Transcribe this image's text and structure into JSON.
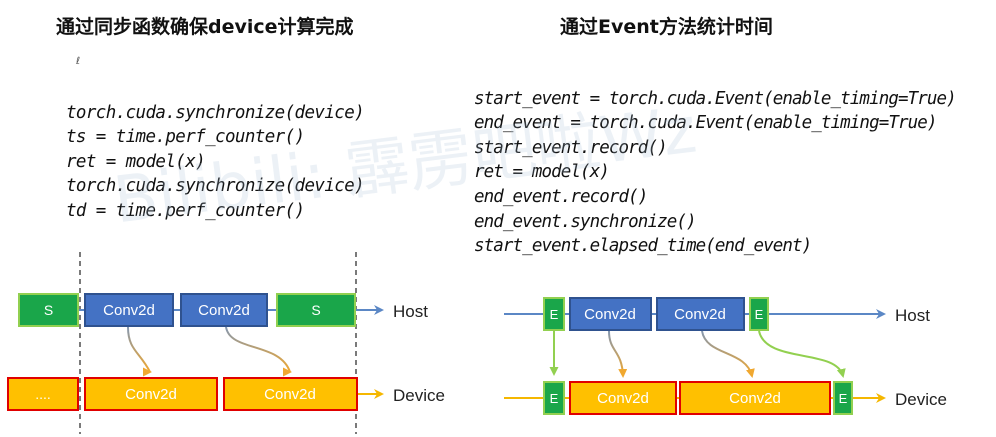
{
  "left": {
    "title": "通过同步函数确保device计算完成",
    "code_lines": [
      "torch.cuda.synchronize(device)",
      "ts = time.perf_counter()",
      "ret = model(x)",
      "torch.cuda.synchronize(device)",
      "td = time.perf_counter()"
    ],
    "host_blocks": [
      "S",
      "Conv2d",
      "Conv2d",
      "S"
    ],
    "device_blocks": [
      "....",
      "Conv2d",
      "Conv2d"
    ],
    "host_label": "Host",
    "device_label": "Device"
  },
  "right": {
    "title": "通过Event方法统计时间",
    "code_lines": [
      "start_event = torch.cuda.Event(enable_timing=True)",
      "end_event = torch.cuda.Event(enable_timing=True)",
      "start_event.record()",
      "ret = model(x)",
      "end_event.record()",
      "end_event.synchronize()",
      "start_event.elapsed_time(end_event)"
    ],
    "host_blocks": [
      "E",
      "Conv2d",
      "Conv2d",
      "E"
    ],
    "device_blocks": [
      "E",
      "Conv2d",
      "Conv2d",
      "E"
    ],
    "host_label": "Host",
    "device_label": "Device"
  },
  "watermark": "Bilibili: 霹雳吧啦Wz",
  "colors": {
    "sync_fill": "#1aa64a",
    "sync_border": "#92d050",
    "conv_host_fill": "#4472c4",
    "conv_host_border": "#2f528f",
    "device_fill": "#ffc000",
    "device_border": "#e00000",
    "arrow_blue": "#5b87c5",
    "arrow_orange": "#f5b700",
    "curve_gray": "#8497b0",
    "curve_green": "#92d050"
  }
}
